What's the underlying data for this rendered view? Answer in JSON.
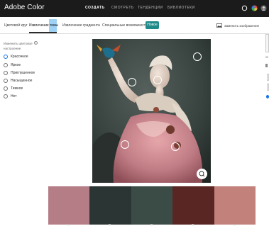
{
  "app": {
    "title": "Adobe Color"
  },
  "nav": {
    "items": [
      {
        "label": "СОЗДАТЬ",
        "active": true
      },
      {
        "label": "СМОТРЕТЬ",
        "active": false
      },
      {
        "label": "ТЕНДЕНЦИИ",
        "active": false
      },
      {
        "label": "БИБЛИОТЕКИ",
        "active": false
      }
    ]
  },
  "tabs": [
    {
      "label": "Цветовой круг"
    },
    {
      "label": "Извлечение темы",
      "active": true
    },
    {
      "label": "Извлечение градиента"
    },
    {
      "label": "Специальные возможности"
    }
  ],
  "badge": {
    "label": "Новое"
  },
  "replace_image": {
    "label": "Заменить изображение"
  },
  "panel": {
    "title": "Изменить цветовое настроение",
    "options": [
      {
        "label": "Красочное",
        "checked": true
      },
      {
        "label": "Яркое",
        "checked": false
      },
      {
        "label": "Приглушенное",
        "checked": false
      },
      {
        "label": "Насыщенное",
        "checked": false
      },
      {
        "label": "Темное",
        "checked": false
      },
      {
        "label": "Нет",
        "checked": false
      }
    ]
  },
  "swatches": [
    "#b57d86",
    "#2b3634",
    "#3b4c47",
    "#5a2623",
    "#c2817a"
  ],
  "colors": {
    "topbar": "#1b1b1b",
    "accent": "#1473e6",
    "badge": "#1f8a8a"
  },
  "icons": [
    "notifications-icon",
    "color-wheel-icon",
    "avatar-icon",
    "image-icon",
    "info-icon",
    "zoom-icon"
  ]
}
